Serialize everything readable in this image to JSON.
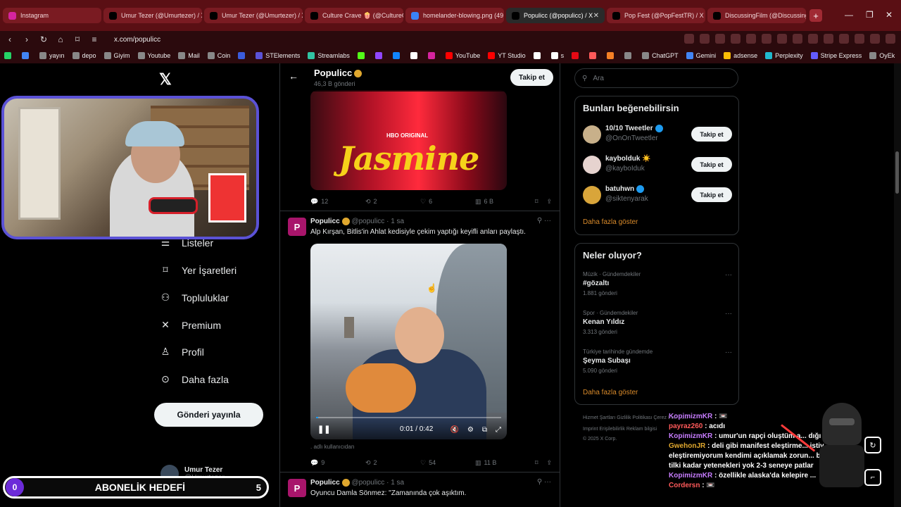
{
  "browser": {
    "tabs": [
      {
        "title": "Instagram",
        "fav_color": "#d6249f",
        "active": false
      },
      {
        "title": "Umur Tezer (@Umurtezer) / X",
        "fav_color": "#000000",
        "active": false
      },
      {
        "title": "Umur Tezer (@Umurtezer) / X",
        "fav_color": "#000000",
        "active": false
      },
      {
        "title": "Culture Crave 🍿 (@CultureCr",
        "fav_color": "#000000",
        "active": false
      },
      {
        "title": "homelander-blowing.png (49",
        "fav_color": "#3b82f6",
        "active": false
      },
      {
        "title": "Populicc (@populicc) / X",
        "fav_color": "#000000",
        "active": true
      },
      {
        "title": "Pop Fest (@PopFestTR) / X",
        "fav_color": "#000000",
        "active": false
      },
      {
        "title": "DiscussingFilm (@DiscussingF",
        "fav_color": "#000000",
        "active": false
      }
    ],
    "new_tab": "+",
    "url": "x.com/populicc",
    "bookmarks": [
      {
        "label": "",
        "color": "#25d366"
      },
      {
        "label": "",
        "color": "#4285f4"
      },
      {
        "label": "yayın",
        "color": "#888888"
      },
      {
        "label": "depo",
        "color": "#888888"
      },
      {
        "label": "Giyim",
        "color": "#888888"
      },
      {
        "label": "Youtube",
        "color": "#888888"
      },
      {
        "label": "Mail",
        "color": "#888888"
      },
      {
        "label": "Coin",
        "color": "#888888"
      },
      {
        "label": "",
        "color": "#3b5bdb"
      },
      {
        "label": "STElements",
        "color": "#5b52d6"
      },
      {
        "label": "Streamlabs",
        "color": "#31c3a2"
      },
      {
        "label": "",
        "color": "#53fc18"
      },
      {
        "label": "",
        "color": "#9146ff"
      },
      {
        "label": "",
        "color": "#1185fe"
      },
      {
        "label": "",
        "color": "#ffffff"
      },
      {
        "label": "",
        "color": "#d6249f"
      },
      {
        "label": "YouTube",
        "color": "#ff0000"
      },
      {
        "label": "YT Studio",
        "color": "#ff0000"
      },
      {
        "label": "",
        "color": "#ffffff"
      },
      {
        "label": "s",
        "color": "#ffffff"
      },
      {
        "label": "",
        "color": "#e50914"
      },
      {
        "label": "",
        "color": "#ff5a5a"
      },
      {
        "label": "",
        "color": "#f58025"
      },
      {
        "label": "",
        "color": "#888888"
      },
      {
        "label": "ChatGPT",
        "color": "#888888"
      },
      {
        "label": "Gemini",
        "color": "#4285f4"
      },
      {
        "label": "adsense",
        "color": "#fbbc05"
      },
      {
        "label": "Perplexity",
        "color": "#20b8cd"
      },
      {
        "label": "Stripe Express",
        "color": "#635bff"
      },
      {
        "label": "OyEk",
        "color": "#888888"
      }
    ]
  },
  "sidebar": {
    "items": [
      {
        "label": "Listeler",
        "icon": "list-icon",
        "glyph": "☰"
      },
      {
        "label": "Yer İşaretleri",
        "icon": "bookmark-icon",
        "glyph": "⌑"
      },
      {
        "label": "Topluluklar",
        "icon": "communities-icon",
        "glyph": "⚇"
      },
      {
        "label": "Premium",
        "icon": "x-premium-icon",
        "glyph": "✕"
      },
      {
        "label": "Profil",
        "icon": "profile-icon",
        "glyph": "♙"
      },
      {
        "label": "Daha fazla",
        "icon": "more-circle-icon",
        "glyph": "⊙"
      }
    ],
    "post_button": "Gönderi yayınla",
    "account": {
      "name": "Umur Tezer",
      "handle": "@Umurtezer"
    }
  },
  "profile_header": {
    "name": "Populicc",
    "post_count": "46,3 B gönderi",
    "follow_label": "Takip et"
  },
  "tweets": [
    {
      "media_text_hbo": "HBO ORIGINAL",
      "media_text_title": "Jasmine",
      "replies": "12",
      "reposts": "2",
      "likes": "6",
      "views": "6 B"
    },
    {
      "author": "Populicc",
      "handle": "@populicc",
      "time": "1 sa",
      "text": "Alp Kırşan, Bitlis'in Ahlat kedisiyle çekim yaptığı keyifli anları paylaştı.",
      "video_time": "0:01 / 0:42",
      "caption": ". adlı kullanıcıdan",
      "replies": "9",
      "reposts": "2",
      "likes": "54",
      "views": "11 B"
    },
    {
      "author": "Populicc",
      "handle": "@populicc",
      "time": "1 sa",
      "text": "Oyuncu Damla Sönmez: \"Zamanında çok aşıktım."
    }
  ],
  "search": {
    "placeholder": "Ara"
  },
  "who_to_follow": {
    "title": "Bunları beğenebilirsin",
    "users": [
      {
        "name": "10/10 Tweetler",
        "handle": "@OnOnTweetler",
        "verified": true,
        "avatar_color": "#c8b08a"
      },
      {
        "name": "kaybolduk ☀️",
        "handle": "@kayboIduk",
        "verified": false,
        "avatar_color": "#e6d3cf"
      },
      {
        "name": "batuhwn",
        "handle": "@siktenyarak",
        "verified": true,
        "avatar_color": "#d9a53a"
      }
    ],
    "follow_label": "Takip et",
    "show_more": "Daha fazla göster"
  },
  "trends": {
    "title": "Neler oluyor?",
    "items": [
      {
        "context": "Müzik · Gündemdekiler",
        "topic": "#gözaltı",
        "count": "1.881 gönderi"
      },
      {
        "context": "Spor · Gündemdekiler",
        "topic": "Kenan Yıldız",
        "count": "3.313 gönderi"
      },
      {
        "context": "Türkiye tarihinde gündemde",
        "topic": "Şeyma Subaşı",
        "count": "5.090 gönderi"
      }
    ],
    "show_more": "Daha fazla göster"
  },
  "footer": {
    "line1": "Hizmet Şartları   Gizlilik Politikası   Çerez Politikası",
    "line2": "Imprint   Erişilebilirlik   Reklam bilgisi",
    "line3": "© 2025 X Corp."
  },
  "overlay": {
    "sub_goal": {
      "current": "0",
      "label": "ABONELİK HEDEFİ",
      "target": "5"
    },
    "chat": [
      {
        "user": "KopimizmKR",
        "msg": " : 📼",
        "cls": "u1"
      },
      {
        "user": "payraz260",
        "msg": " : acıdı",
        "cls": "u2"
      },
      {
        "user": "KopimizmKR",
        "msg": " : umur'un rapçi oluştüm a... dığı evren",
        "cls": "u1"
      },
      {
        "user": "GwehonJR",
        "msg": " : deli gibi manifest eleştirme... istiy",
        "cls": "u3"
      },
      {
        "user": "",
        "msg": "eleştiremiyorum kendimi açıklamak zorun... bir aleyna",
        "cls": "cont"
      },
      {
        "user": "",
        "msg": "tilki kadar yetenekleri yok 2-3 seneye patlar",
        "cls": "cont"
      },
      {
        "user": "KopimizmKR",
        "msg": " : özellikle alaska'da kelepire ...",
        "cls": "u1"
      },
      {
        "user": "Cordersn",
        "msg": " : 📼",
        "cls": "u4"
      }
    ]
  }
}
